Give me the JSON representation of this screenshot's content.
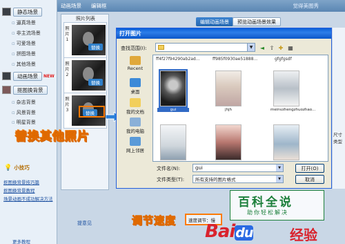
{
  "sidebar": {
    "static_scene": "静态场景",
    "static_items": [
      "逼真场景",
      "非主流场景",
      "可爱场景",
      "拼图场景",
      "其他场景"
    ],
    "animated_scene": "动画场景",
    "animated_badge": "NEW",
    "bg_scene": "抠图换背景",
    "bg_items": [
      "杂志背景",
      "风景背景",
      "明星背景"
    ],
    "tips_title": "小技巧",
    "tips": [
      "抠图换背景技巧篇",
      "抠图换背景教程",
      "场景动画不成功解决方法"
    ],
    "bottom_link": "更多教程"
  },
  "topbar": {
    "tab1": "动画场景",
    "tab2": "编辑框",
    "right": "觉得美图秀"
  },
  "photo_panel": {
    "title": "照片列表",
    "slots": [
      {
        "num": "照片1",
        "replace": "替换"
      },
      {
        "num": "照片2",
        "replace": "替换"
      },
      {
        "num": "照片3",
        "replace": "替换"
      }
    ]
  },
  "captions": {
    "replace_other": "替换其他照片",
    "adjust_speed": "调节速度"
  },
  "tabs": {
    "edit": "编辑动画场景",
    "preview": "预览动画场景效果"
  },
  "dialog": {
    "title": "打开图片",
    "look_in_label": "查找范围(I):",
    "look_in_value": "",
    "places": [
      "Recent",
      "桌面",
      "我的文档",
      "我的电脑",
      "网上邻居"
    ],
    "top_filenames": [
      "ff4f27f94290ab2ad...",
      "ff985f0930ae51888...",
      "gfgfgsdf"
    ],
    "files": [
      {
        "name": "gui",
        "selected": true
      },
      {
        "name": "jhjh",
        "selected": false
      },
      {
        "name": "meinvzhengzhuozhao...",
        "selected": false
      },
      {
        "name": "",
        "selected": false
      },
      {
        "name": "",
        "selected": false
      },
      {
        "name": "",
        "selected": false
      }
    ],
    "filename_label": "文件名(N):",
    "filename_value": "gui",
    "filetype_label": "文件类型(T):",
    "filetype_value": "所有支持的图片格式",
    "open_button": "打开(O)",
    "cancel_button": "取消"
  },
  "right_side": {
    "size_label": "尺寸",
    "type_label": "类型"
  },
  "bottom": {
    "preview": "提意见",
    "speed_label": "速度调节：",
    "speed_value": "慢"
  },
  "watermark": {
    "title": "百科全说",
    "subtitle": "助你轻松解决",
    "baidu_bai": "Bai",
    "baidu_du": "du",
    "jingyan": "经验"
  },
  "colors": {
    "accent": "#2f7fc9",
    "highlight": "#ff7a00",
    "watermark": "#1b7f3a"
  }
}
